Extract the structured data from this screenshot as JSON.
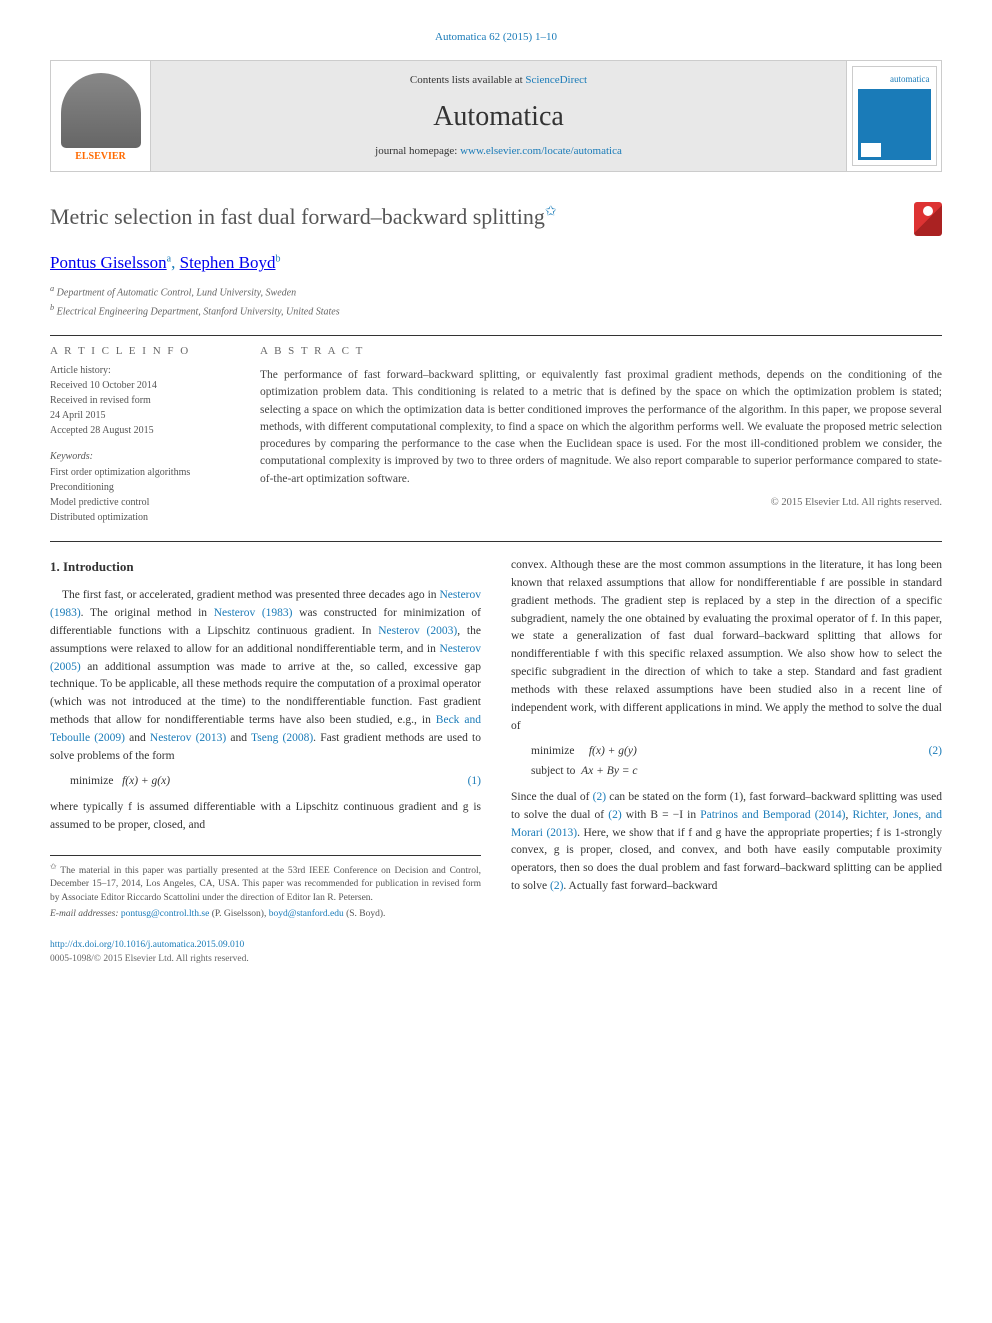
{
  "citation": "Automatica 62 (2015) 1–10",
  "banner": {
    "contents_prefix": "Contents lists available at ",
    "contents_link": "ScienceDirect",
    "journal": "Automatica",
    "homepage_prefix": "journal homepage: ",
    "homepage_link": "www.elsevier.com/locate/automatica",
    "elsevier": "ELSEVIER",
    "cover_title": "automatica"
  },
  "title": "Metric selection in fast dual forward–backward splitting",
  "star": "✩",
  "authors": {
    "a1_name": "Pontus Giselsson",
    "a1_aff": "a",
    "a2_name": "Stephen Boyd",
    "a2_aff": "b"
  },
  "affiliations": {
    "a": "Department of Automatic Control, Lund University, Sweden",
    "b": "Electrical Engineering Department, Stanford University, United States"
  },
  "article_info": {
    "header": "A R T I C L E   I N F O",
    "history_label": "Article history:",
    "h1": "Received 10 October 2014",
    "h2": "Received in revised form",
    "h3": "24 April 2015",
    "h4": "Accepted 28 August 2015",
    "keywords_label": "Keywords:",
    "k1": "First order optimization algorithms",
    "k2": "Preconditioning",
    "k3": "Model predictive control",
    "k4": "Distributed optimization"
  },
  "abstract": {
    "header": "A B S T R A C T",
    "text": "The performance of fast forward–backward splitting, or equivalently fast proximal gradient methods, depends on the conditioning of the optimization problem data. This conditioning is related to a metric that is defined by the space on which the optimization problem is stated; selecting a space on which the optimization data is better conditioned improves the performance of the algorithm. In this paper, we propose several methods, with different computational complexity, to find a space on which the algorithm performs well. We evaluate the proposed metric selection procedures by comparing the performance to the case when the Euclidean space is used. For the most ill-conditioned problem we consider, the computational complexity is improved by two to three orders of magnitude. We also report comparable to superior performance compared to state-of-the-art optimization software.",
    "copyright": "© 2015 Elsevier Ltd. All rights reserved."
  },
  "body": {
    "section1": "1. Introduction",
    "col1_p1a": "The first fast, or accelerated, gradient method was presented three decades ago in ",
    "ref_nesterov1983_a": "Nesterov (1983)",
    "col1_p1b": ". The original method in ",
    "ref_nesterov1983_b": "Nesterov (1983)",
    "col1_p1c": " was constructed for minimization of differentiable functions with a Lipschitz continuous gradient. In ",
    "ref_nesterov2003": "Nesterov (2003)",
    "col1_p1d": ", the assumptions were relaxed to allow for an additional nondifferentiable term, and in ",
    "ref_nesterov2005": "Nesterov (2005)",
    "col1_p1e": " an additional assumption was made to arrive at the, so called, excessive gap technique. To be applicable, all these methods require the computation of a proximal operator (which was not introduced at the time) to the nondifferentiable function. Fast gradient methods that allow for nondifferentiable terms have also been studied, e.g., in ",
    "ref_beck": "Beck and Teboulle (2009)",
    "col1_p1f": " and ",
    "ref_nesterov2013": "Nesterov (2013)",
    "col1_p1g": " and ",
    "ref_tseng": "Tseng (2008)",
    "col1_p1h": ". Fast gradient methods are used to solve problems of the form",
    "eq1_label": "minimize",
    "eq1": "f(x) + g(x)",
    "eq1_num": "(1)",
    "col1_p2": "where typically f is assumed differentiable with a Lipschitz continuous gradient and g is assumed to be proper, closed, and",
    "col2_p1a": "convex. Although these are the most common assumptions in the literature, it has long been known that relaxed assumptions that allow for nondifferentiable f are possible in standard gradient methods. The gradient step is replaced by a step in the direction of a specific subgradient, namely the one obtained by evaluating the proximal operator of f. In this paper, we state a generalization of fast dual forward–backward splitting that allows for nondifferentiable f with this specific relaxed assumption. We also show how to select the specific subgradient in the direction of which to take a step. Standard and fast gradient methods with these relaxed assumptions have been studied also in a recent line of independent work, with different applications in mind. We apply the method to solve the dual of",
    "eq2_label": "minimize",
    "eq2_l1": "f(x) + g(y)",
    "eq2_l2_label": "subject to",
    "eq2_l2": "Ax + By = c",
    "eq2_num": "(2)",
    "col2_p2a": "Since the dual of ",
    "ref_eq2_a": "(2)",
    "col2_p2b": " can be stated on the form (1), fast forward–backward splitting was used to solve the dual of ",
    "ref_eq2_b": "(2)",
    "col2_p2c": " with B = −I in ",
    "ref_patrinos": "Patrinos and Bemporad (2014)",
    "col2_p2d": ", ",
    "ref_richter": "Richter, Jones, and Morari (2013)",
    "col2_p2e": ". Here, we show that if f and g have the appropriate properties; f is 1-strongly convex, g is proper, closed, and convex, and both have easily computable proximity operators, then so does the dual problem and fast forward–backward splitting can be applied to solve ",
    "ref_eq2_c": "(2)",
    "col2_p2f": ". Actually fast forward–backward"
  },
  "footnotes": {
    "f1": "The material in this paper was partially presented at the 53rd IEEE Conference on Decision and Control, December 15–17, 2014, Los Angeles, CA, USA. This paper was recommended for publication in revised form by Associate Editor Riccardo Scattolini under the direction of Editor Ian R. Petersen.",
    "email_label": "E-mail addresses:",
    "email1": "pontusg@control.lth.se",
    "email1_who": " (P. Giselsson), ",
    "email2": "boyd@stanford.edu",
    "email2_who": "(S. Boyd)."
  },
  "doi": {
    "link": "http://dx.doi.org/10.1016/j.automatica.2015.09.010",
    "copyright": "0005-1098/© 2015 Elsevier Ltd. All rights reserved."
  }
}
